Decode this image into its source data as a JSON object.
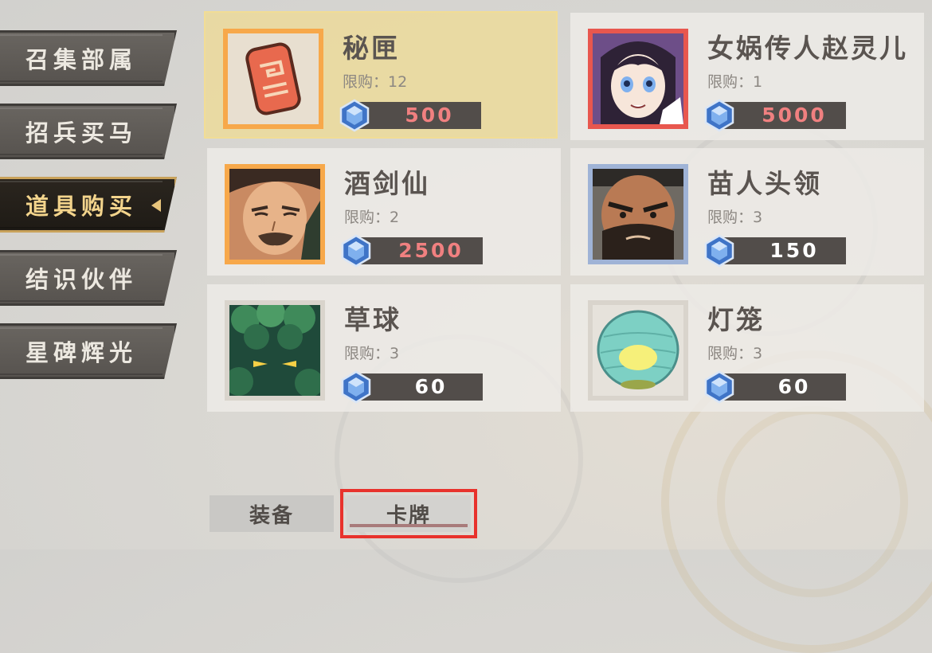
{
  "sidebar": {
    "items": [
      {
        "label": "召集部属"
      },
      {
        "label": "招兵买马"
      },
      {
        "label": "道具购买",
        "active": true
      },
      {
        "label": "结识伙伴"
      },
      {
        "label": "星碑辉光"
      }
    ]
  },
  "shop": {
    "currency_icon": "blue-gem-icon",
    "items": [
      {
        "name": "秘匣",
        "limit": "限购：12",
        "price": "500",
        "price_color": "#f08080",
        "frame_color": "#f7a84a",
        "icon": "treasure-token-icon",
        "selected": true
      },
      {
        "name": "女娲传人赵灵儿",
        "limit": "限购：1",
        "price": "5000",
        "price_color": "#f08080",
        "frame_color": "#e8574e",
        "icon": "zhao-linger-portrait"
      },
      {
        "name": "酒剑仙",
        "limit": "限购：2",
        "price": "2500",
        "price_color": "#f08080",
        "frame_color": "#f7a84a",
        "icon": "jiujianxian-portrait"
      },
      {
        "name": "苗人头领",
        "limit": "限购：3",
        "price": "150",
        "price_color": "#ffffff",
        "frame_color": "#9fb3d6",
        "icon": "miao-chief-portrait"
      },
      {
        "name": "草球",
        "limit": "限购：3",
        "price": "60",
        "price_color": "#ffffff",
        "frame_color": "#d9d4cc",
        "icon": "grass-ball-portrait"
      },
      {
        "name": "灯笼",
        "limit": "限购：3",
        "price": "60",
        "price_color": "#ffffff",
        "frame_color": "#d9d4cc",
        "icon": "lantern-portrait"
      }
    ]
  },
  "tabs": [
    {
      "label": "装备"
    },
    {
      "label": "卡牌",
      "active": true
    }
  ]
}
